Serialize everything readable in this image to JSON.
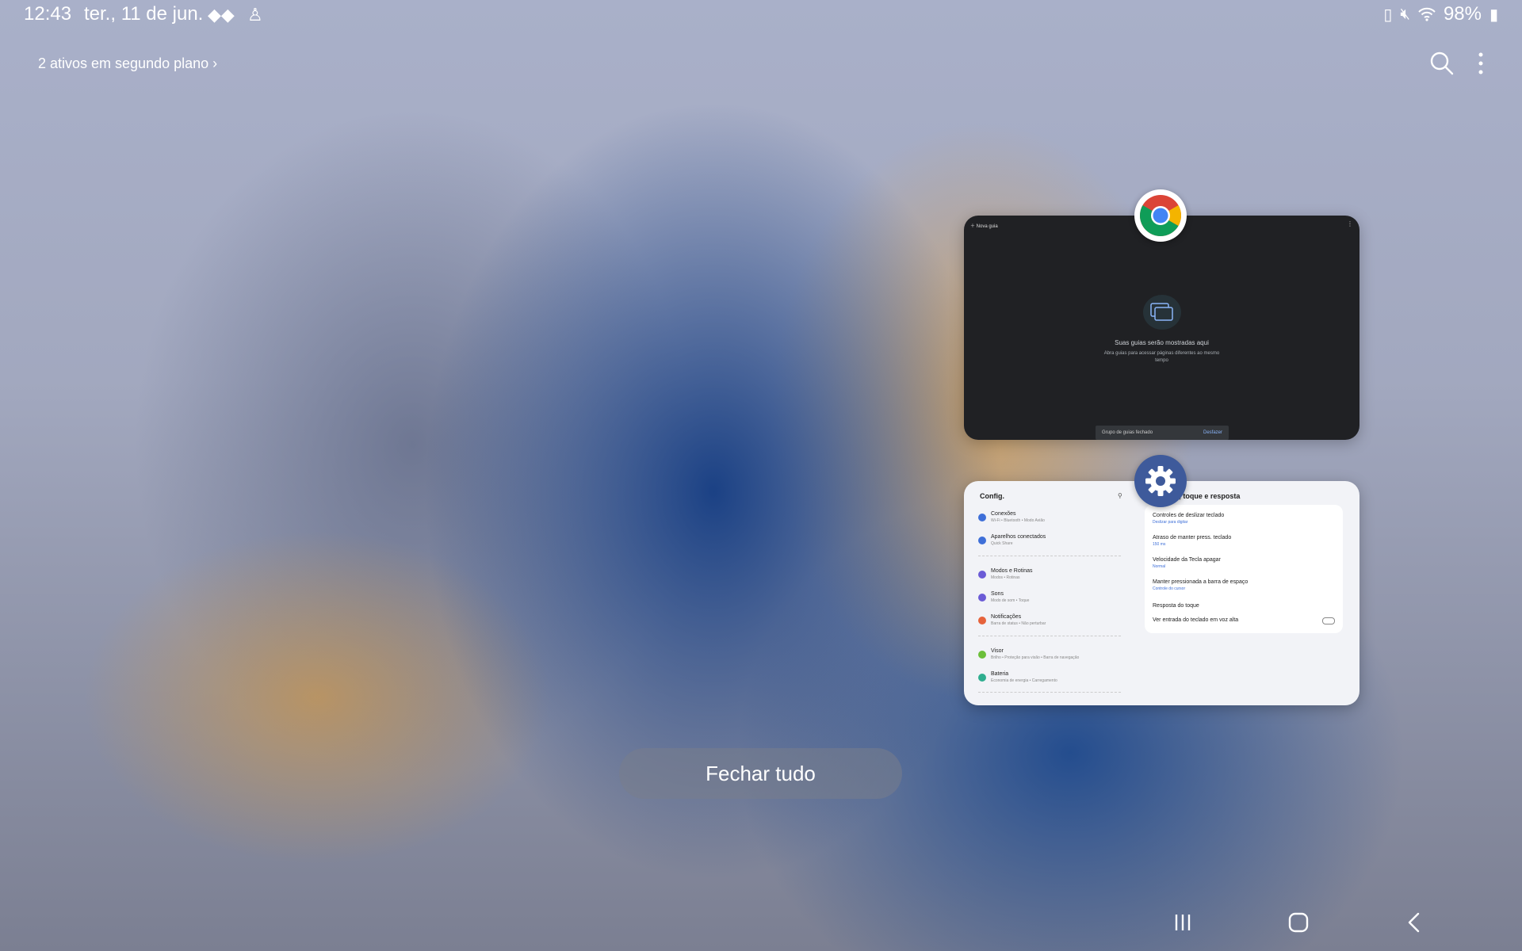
{
  "status_bar": {
    "time": "12:43",
    "date": "ter., 11 de jun.",
    "battery": "98%"
  },
  "recents": {
    "background_apps_label": "2 ativos em segundo plano ›",
    "close_all_label": "Fechar tudo"
  },
  "chrome_card": {
    "app": "chrome",
    "new_tab": "Nova guia",
    "empty_title": "Suas guias serão mostradas aqui",
    "empty_body": "Abra guias para acessar páginas diferentes ao mesmo tempo",
    "snackbar_text": "Grupo de guias fechado",
    "snackbar_action": "Desfazer"
  },
  "settings_card": {
    "app": "settings",
    "title": "Config.",
    "right_title": "Teclado, toque e resposta",
    "items": [
      {
        "title": "Conexões",
        "sub": "Wi-Fi • Bluetooth • Modo Avião",
        "color": "#3e6fd8"
      },
      {
        "title": "Aparelhos conectados",
        "sub": "Quick Share",
        "color": "#3e6fd8"
      },
      {
        "title": "Modos e Rotinas",
        "sub": "Modos • Rotinas",
        "color": "#6b5bd6"
      },
      {
        "title": "Sons",
        "sub": "Modo de som • Toque",
        "color": "#6b5bd6"
      },
      {
        "title": "Notificações",
        "sub": "Barra de status • Não perturbar",
        "color": "#e6633c"
      },
      {
        "title": "Visor",
        "sub": "Brilho • Proteção para visão • Barra de navegação",
        "color": "#6cbf3a"
      },
      {
        "title": "Bateria",
        "sub": "Economia de energia • Carregamento",
        "color": "#2fae8f"
      }
    ],
    "rows": [
      {
        "title": "Controles de deslizar teclado",
        "sub": "Deslizar para digitar"
      },
      {
        "title": "Atraso de manter press. teclado",
        "sub": "150 ms"
      },
      {
        "title": "Velocidade da Tecla apagar",
        "sub": "Normal"
      },
      {
        "title": "Manter pressionada a barra de espaço",
        "sub": "Controle do cursor"
      },
      {
        "title": "Resposta do toque",
        "sub": ""
      },
      {
        "title": "Ver entrada do teclado em voz alta",
        "sub": ""
      }
    ]
  },
  "nav_bar": {
    "recents": "recents-icon",
    "home": "home-icon",
    "back": "back-icon"
  }
}
